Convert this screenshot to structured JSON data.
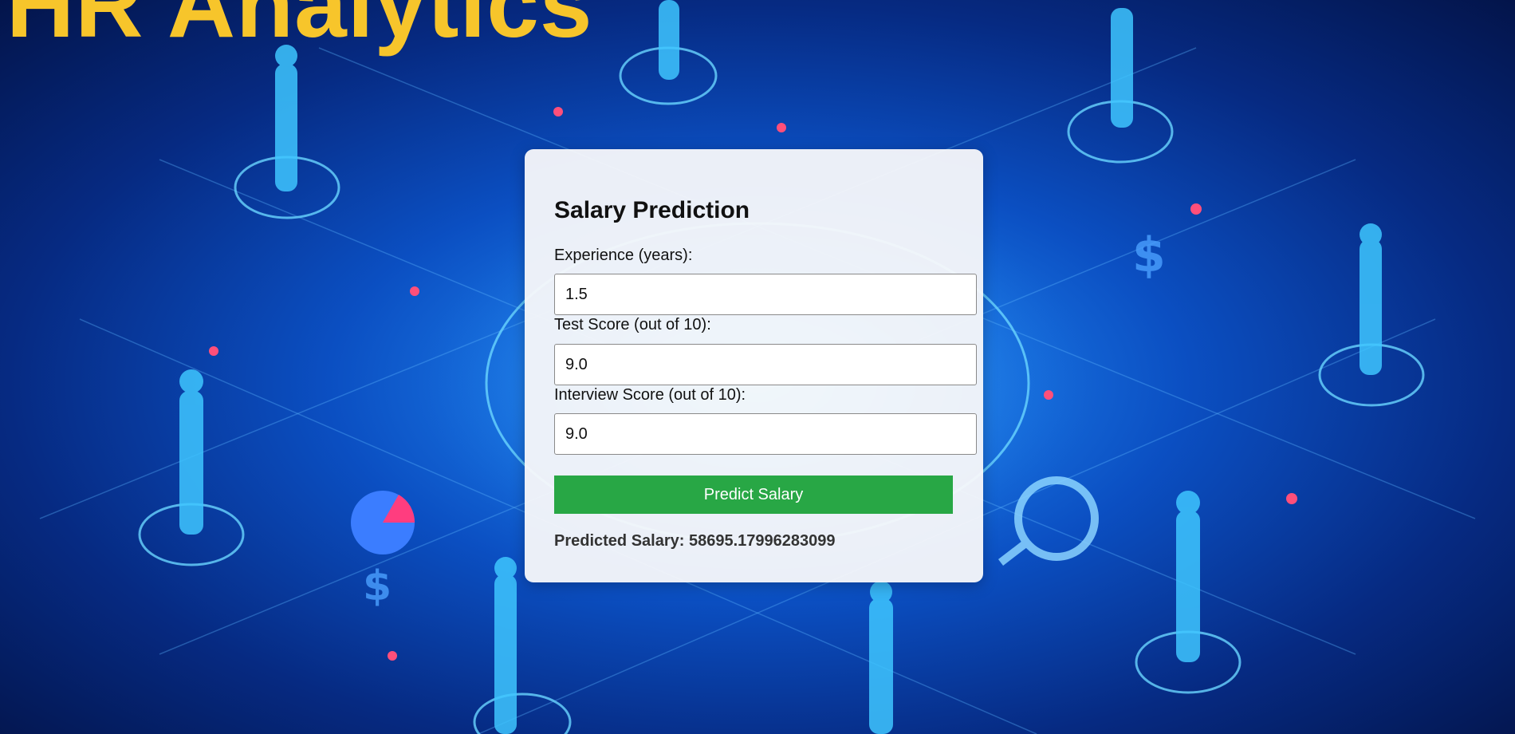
{
  "hero": {
    "title": "HR Analytics"
  },
  "form": {
    "title": "Salary Prediction",
    "fields": [
      {
        "label": "Experience (years):",
        "value": "1.5"
      },
      {
        "label": "Test Score (out of 10):",
        "value": "9.0"
      },
      {
        "label": "Interview Score (out of 10):",
        "value": "9.0"
      }
    ],
    "submit_label": "Predict Salary",
    "result_text": "Predicted Salary: 58695.17996283099"
  },
  "colors": {
    "accent_title": "#f7c52b",
    "button": "#28a745",
    "background_primary": "#0b4fc2"
  }
}
